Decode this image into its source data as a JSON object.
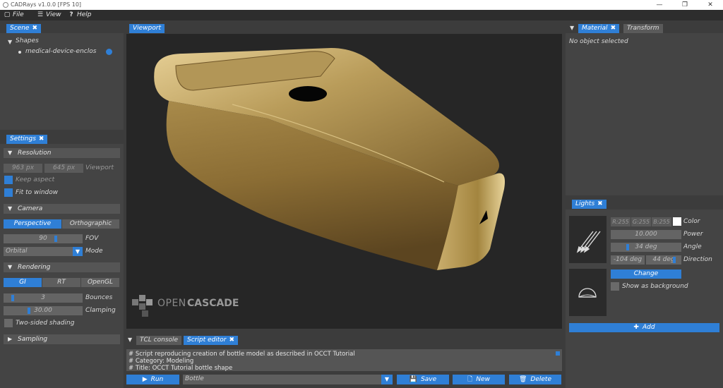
{
  "window": {
    "title": "CADRays v1.0.0 [FPS 10]",
    "minimize": "—",
    "maximize": "❐",
    "close": "✕"
  },
  "menu": [
    {
      "label": "File",
      "icon": "file-icon"
    },
    {
      "label": "View",
      "icon": "list-icon"
    },
    {
      "label": "Help",
      "icon": "help-icon"
    }
  ],
  "scene": {
    "tab": "Scene",
    "tree_root": "Shapes",
    "shape_item": "medical-device-enclos"
  },
  "settings": {
    "tab": "Settings",
    "resolution": {
      "header": "Resolution",
      "width": "963 px",
      "height": "645 px",
      "viewport_label": "Viewport",
      "keep_aspect": "Keep aspect",
      "fit_to_window": "Fit to window"
    },
    "camera": {
      "header": "Camera",
      "perspective": "Perspective",
      "orthographic": "Orthographic",
      "fov_value": "90",
      "fov_label": "FOV",
      "mode_value": "Orbital",
      "mode_label": "Mode"
    },
    "rendering": {
      "header": "Rendering",
      "gi": "GI",
      "rt": "RT",
      "opengl": "OpenGL",
      "bounces_value": "3",
      "bounces_label": "Bounces",
      "clamping_value": "30.00",
      "clamping_label": "Clamping",
      "two_sided": "Two-sided shading"
    },
    "sampling": {
      "header": "Sampling"
    }
  },
  "viewport": {
    "tab": "Viewport",
    "logo_text_1": "OPEN",
    "logo_text_2": "CASCADE"
  },
  "material": {
    "tab_material": "Material",
    "tab_transform": "Transform",
    "status": "No object selected"
  },
  "lights": {
    "tab": "Lights",
    "r": "R:255",
    "g": "G:255",
    "b": "B:255",
    "color_label": "Color",
    "power_value": "10.000",
    "power_label": "Power",
    "angle_value": "34 deg",
    "angle_label": "Angle",
    "dir_x": "-104 deg",
    "dir_y": "44 deg",
    "direction_label": "Direction",
    "change_button": "Change",
    "show_background": "Show as background",
    "add_button": "Add"
  },
  "console": {
    "tab_tcl": "TCL console",
    "tab_script": "Script editor",
    "lines": [
      "# Script reproducing creation of bottle model as described in OCCT Tutorial",
      "# Category: Modeling",
      "# Title: OCCT Tutorial bottle shape"
    ],
    "run_button": "Run",
    "script_select": "Bottle",
    "save_button": "Save",
    "new_button": "New",
    "delete_button": "Delete"
  },
  "colors": {
    "accent": "#2f7fd6",
    "panel": "#444444",
    "viewport_bg": "#262626",
    "gold": "#a88a4a"
  }
}
